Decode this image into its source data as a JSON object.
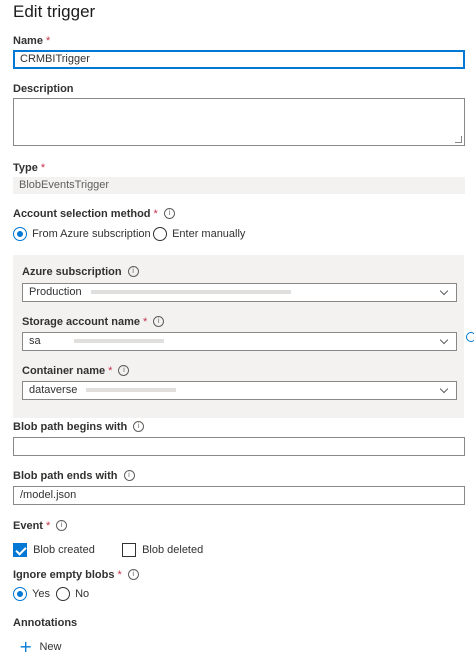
{
  "page": {
    "title": "Edit trigger"
  },
  "name": {
    "label": "Name",
    "required": "*",
    "value": "CRMBITrigger"
  },
  "description": {
    "label": "Description",
    "value": ""
  },
  "type": {
    "label": "Type",
    "required": "*",
    "value": "BlobEventsTrigger"
  },
  "account_selection": {
    "label": "Account selection method",
    "required": "*",
    "info_icon": "i",
    "options": [
      "From Azure subscription",
      "Enter manually"
    ],
    "selected": "From Azure subscription"
  },
  "azure_subscription": {
    "label": "Azure subscription",
    "info_icon": "i",
    "value": "Production"
  },
  "storage_account": {
    "label": "Storage account name",
    "required": "*",
    "info_icon": "i",
    "value": "sa"
  },
  "container": {
    "label": "Container name",
    "required": "*",
    "info_icon": "i",
    "value": "dataverse"
  },
  "blob_begins": {
    "label": "Blob path begins with",
    "info_icon": "i",
    "value": ""
  },
  "blob_ends": {
    "label": "Blob path ends with",
    "info_icon": "i",
    "value": "/model.json"
  },
  "event": {
    "label": "Event",
    "required": "*",
    "info_icon": "i",
    "options": [
      {
        "label": "Blob created",
        "checked": true
      },
      {
        "label": "Blob deleted",
        "checked": false
      }
    ]
  },
  "ignore_empty": {
    "label": "Ignore empty blobs",
    "required": "*",
    "info_icon": "i",
    "options": [
      "Yes",
      "No"
    ],
    "selected": "Yes"
  },
  "annotations": {
    "label": "Annotations",
    "new_label": "New",
    "plus_icon": "+"
  },
  "colors": {
    "accent": "#0078d4",
    "required": "#c4314b",
    "panel": "#f3f2f1",
    "border": "#8a8886"
  }
}
